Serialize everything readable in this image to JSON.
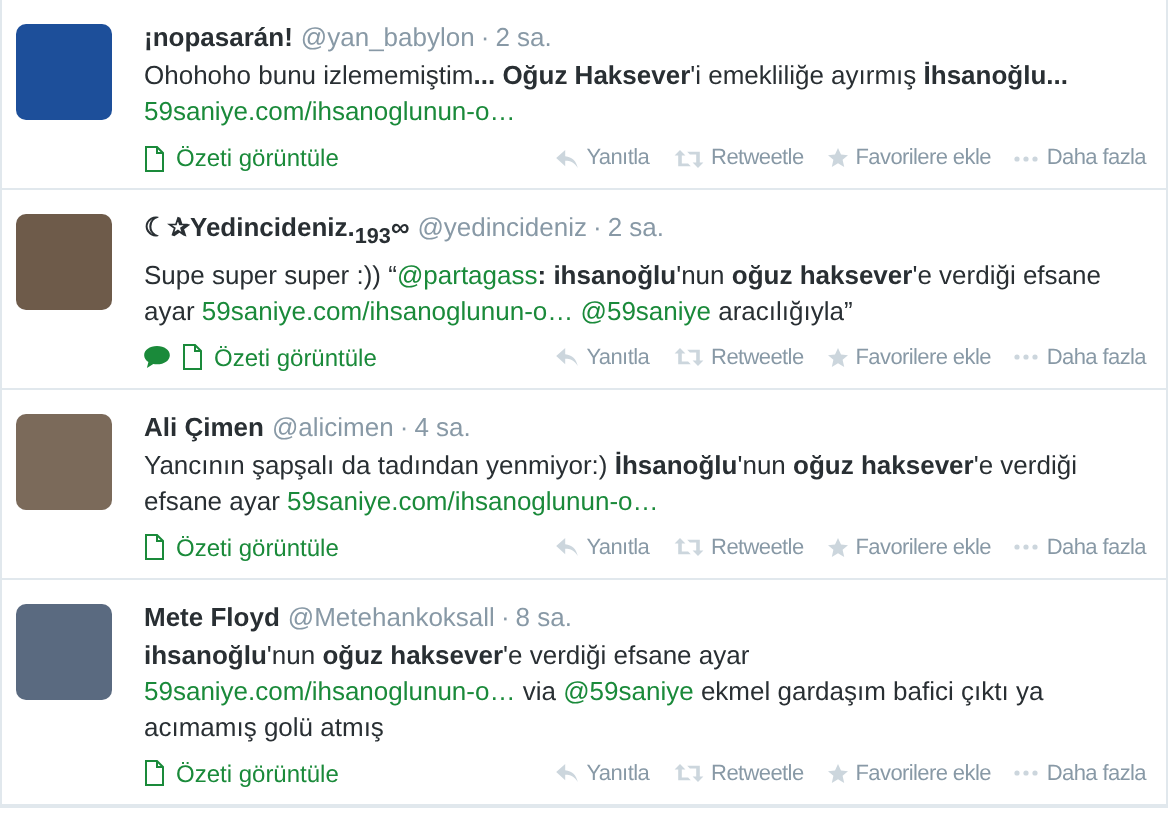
{
  "tweets": [
    {
      "name": "¡nopasarán!",
      "handle": "@yan_babylon",
      "sep": "·",
      "time": "2 sa.",
      "conversation": false,
      "text": [
        {
          "kind": "text",
          "text": "Ohohoho bunu izlememiştim**... Oğuz Haksever**'i emekliliğe ayırmış **İhsanoğlu...**"
        },
        {
          "kind": "break"
        },
        {
          "kind": "link",
          "text": "59saniye.com/ihsanoglunun-o…"
        }
      ],
      "summary": "Özeti görüntüle",
      "actions": [
        "Yanıtla",
        "Retweetle",
        "Favorilere ekle",
        "Daha fazla"
      ]
    },
    {
      "name": "☾✰Yedincideniz.$_{193}$∞",
      "handle": "@yedincideniz",
      "sep": "·",
      "time": "2 sa.",
      "conversation": true,
      "text": [
        {
          "kind": "text",
          "text": "Supe super super :)) “"
        },
        {
          "kind": "link",
          "text": "@partagass"
        },
        {
          "kind": "text",
          "text": "**: ihsanoğlu**'nun **oğuz haksever**'e verdiği efsane ayar "
        },
        {
          "kind": "link",
          "text": "59saniye.com/ihsanoglunun-o…"
        },
        {
          "kind": "link",
          "text": "@59saniye"
        },
        {
          "kind": "text",
          "text": " aracılığıyla”"
        }
      ],
      "summary": "Özeti görüntüle",
      "actions": [
        "Yanıtla",
        "Retweetle",
        "Favorilere ekle",
        "Daha fazla"
      ]
    },
    {
      "name": "Ali Çimen",
      "handle": "@alicimen",
      "sep": "·",
      "time": "4 sa.",
      "conversation": false,
      "text": [
        {
          "kind": "text",
          "text": "Yancının şapşalı da tadından yenmiyor:) **İhsanoğlu**'nun **oğuz haksever**'e verdiği efsane ayar "
        },
        {
          "kind": "link",
          "text": "59saniye.com/ihsanoglunun-o…"
        }
      ],
      "summary": "Özeti görüntüle",
      "actions": [
        "Yanıtla",
        "Retweetle",
        "Favorilere ekle",
        "Daha fazla"
      ]
    },
    {
      "name": "Mete Floyd",
      "handle": "@Metehankoksall",
      "sep": "·",
      "time": "8 sa.",
      "conversation": false,
      "text": [
        {
          "kind": "text",
          "text": "**ihsanoğlu**'nun **oğuz haksever**'e verdiği efsane ayar"
        },
        {
          "kind": "break"
        },
        {
          "kind": "link",
          "text": "59saniye.com/ihsanoglunun-o…"
        },
        {
          "kind": "text",
          "text": " via "
        },
        {
          "kind": "link",
          "text": "@59saniye"
        },
        {
          "kind": "text",
          "text": " ekmel gardaşım bafici çıktı ya acımamış golü atmış"
        }
      ],
      "summary": "Özeti görüntüle",
      "actions": [
        "Yanıtla",
        "Retweetle",
        "Favorilere ekle",
        "Daha fazla"
      ]
    }
  ]
}
